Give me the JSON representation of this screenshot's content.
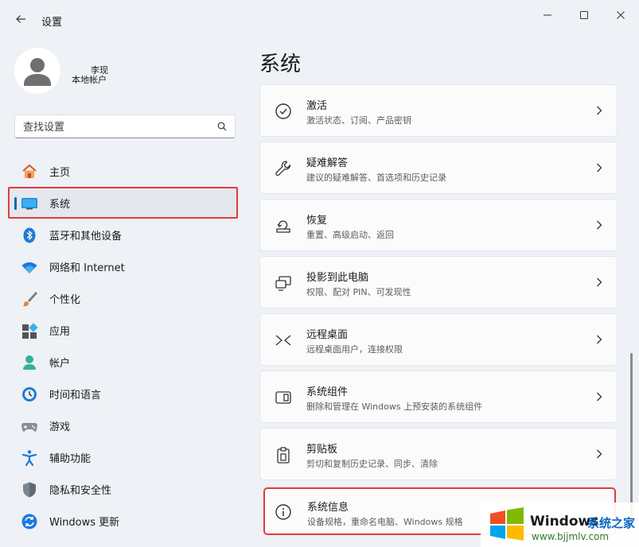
{
  "window": {
    "title": "设置"
  },
  "profile": {
    "user_name": "李现",
    "account_type": "本地帐户"
  },
  "search": {
    "placeholder": "查找设置"
  },
  "nav": [
    {
      "label": "主页",
      "icon": "home-icon"
    },
    {
      "label": "系统",
      "icon": "system-icon",
      "selected": true
    },
    {
      "label": "蓝牙和其他设备",
      "icon": "bluetooth-icon"
    },
    {
      "label": "网络和 Internet",
      "icon": "wifi-icon"
    },
    {
      "label": "个性化",
      "icon": "brush-icon"
    },
    {
      "label": "应用",
      "icon": "apps-icon"
    },
    {
      "label": "帐户",
      "icon": "account-icon"
    },
    {
      "label": "时间和语言",
      "icon": "globe-clock-icon"
    },
    {
      "label": "游戏",
      "icon": "gamepad-icon"
    },
    {
      "label": "辅助功能",
      "icon": "accessibility-icon"
    },
    {
      "label": "隐私和安全性",
      "icon": "shield-icon"
    },
    {
      "label": "Windows 更新",
      "icon": "update-icon"
    }
  ],
  "main": {
    "title": "系统",
    "cards": [
      {
        "title": "激活",
        "desc": "激活状态、订阅、产品密钥",
        "icon": "check-circle-icon"
      },
      {
        "title": "疑难解答",
        "desc": "建议的疑难解答、首选项和历史记录",
        "icon": "wrench-icon"
      },
      {
        "title": "恢复",
        "desc": "重置、高级启动、返回",
        "icon": "recovery-icon"
      },
      {
        "title": "投影到此电脑",
        "desc": "权限、配对 PIN、可发现性",
        "icon": "projection-icon"
      },
      {
        "title": "远程桌面",
        "desc": "远程桌面用户，连接权限",
        "icon": "remote-desktop-icon"
      },
      {
        "title": "系统组件",
        "desc": "删除和管理在 Windows 上预安装的系统组件",
        "icon": "components-icon"
      },
      {
        "title": "剪贴板",
        "desc": "剪切和复制历史记录、同步、清除",
        "icon": "clipboard-icon"
      },
      {
        "title": "系统信息",
        "desc": "设备规格，重命名电脑、Windows 规格",
        "icon": "info-icon"
      }
    ]
  },
  "watermark": {
    "brand": "Windows",
    "brand_cn": "系统之家",
    "url": "www.bjjmlv.com"
  }
}
